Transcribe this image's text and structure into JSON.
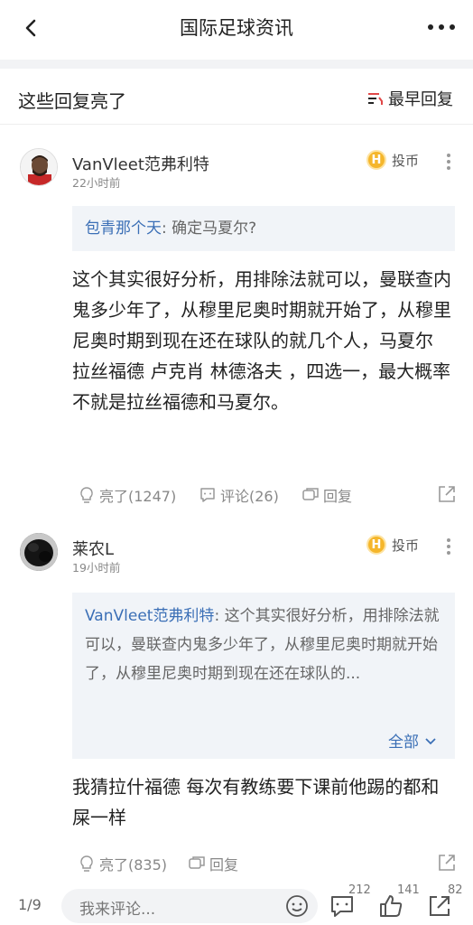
{
  "header": {
    "title": "国际足球资讯"
  },
  "section": {
    "title": "这些回复亮了",
    "sort_label": "最早回复"
  },
  "comments": [
    {
      "username": "VanVleet范弗利特",
      "time": "22小时前",
      "coin_label": "投币",
      "coin_symbol": "H",
      "quote_user": "包青那个天",
      "quote_text": ": 确定马夏尔?",
      "body": "这个其实很好分析，用排除法就可以，曼联查内鬼多少年了，从穆里尼奥时期就开始了，从穆里尼奥时期到现在还在球队的就几个人，马夏尔 拉丝福德 卢克肖 林德洛夫 ，四选一，最大概率不就是拉丝福德和马夏尔。",
      "like_label": "亮了(1247)",
      "comment_label": "评论(26)",
      "reply_label": "回复"
    },
    {
      "username": "莱农L",
      "time": "19小时前",
      "coin_label": "投币",
      "coin_symbol": "H",
      "quote_user": "VanVleet范弗利特",
      "quote_text": ": 这个其实很好分析，用排除法就可以，曼联查内鬼多少年了，从穆里尼奥时期就开始了，从穆里尼奥时期到现在还在球队的...",
      "expand_label": "全部",
      "body": "我猜拉什福德 每次有教练要下课前他踢的都和屎一样",
      "like_label": "亮了(835)",
      "reply_label": "回复"
    }
  ],
  "bottom": {
    "page": "1/9",
    "placeholder": "我来评论...",
    "comment_count": "212",
    "like_count": "141",
    "share_count": "82"
  }
}
